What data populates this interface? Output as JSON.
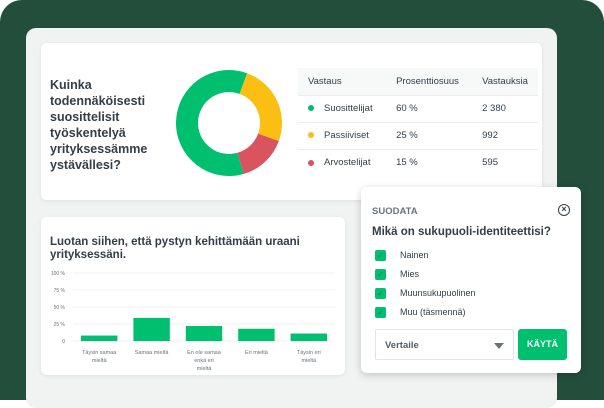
{
  "colors": {
    "background": "#234e3c",
    "accent": "#00bf6f",
    "promoters": "#00bf6f",
    "passives": "#fbbf14",
    "detractors": "#d9545f"
  },
  "nps_card": {
    "question": "Kuinka todennäköisesti suosittelisit työskentelyä yrityksessämme ystävällesi?",
    "table": {
      "headers": [
        "Vastaus",
        "Prosenttiosuus",
        "Vastauksia"
      ],
      "rows": [
        {
          "label": "Suosittelijat",
          "percent": "60 %",
          "count": "2 380",
          "color": "#00bf6f"
        },
        {
          "label": "Passiiviset",
          "percent": "25 %",
          "count": "992",
          "color": "#fbbf14"
        },
        {
          "label": "Arvostelijat",
          "percent": "15 %",
          "count": "595",
          "color": "#d9545f"
        }
      ]
    }
  },
  "chart_data": [
    {
      "type": "pie",
      "donut": true,
      "categories": [
        "Suosittelijat",
        "Passiiviset",
        "Arvostelijat"
      ],
      "values": [
        60,
        25,
        15
      ],
      "colors": [
        "#00bf6f",
        "#fbbf14",
        "#d9545f"
      ]
    },
    {
      "type": "bar",
      "title": "Luotan siihen, että pystyn kehittämään uraani yrityksessäni.",
      "categories": [
        "Täysin samaa mieltä",
        "Samaa mieltä",
        "En ole samaa enkä eri mieltä",
        "Eri mieltä",
        "Täysin eri mieltä"
      ],
      "values": [
        8,
        34,
        22,
        18,
        11
      ],
      "ylim": [
        0,
        100
      ],
      "yticks": [
        "100 %",
        "75 %",
        "50 %",
        "25 %",
        "0"
      ],
      "grid": true,
      "color": "#00bf6f"
    }
  ],
  "filter": {
    "title": "SUODATA",
    "close_icon": "circle-x-icon",
    "question": "Mikä on sukupuoli-identiteettisi?",
    "options": [
      {
        "label": "Nainen",
        "checked": true
      },
      {
        "label": "Mies",
        "checked": true
      },
      {
        "label": "Muunsukupuolinen",
        "checked": true
      },
      {
        "label": "Muu (täsmennä)",
        "checked": true
      }
    ],
    "compare_select": "Vertaile",
    "apply_label": "KÄYTÄ"
  }
}
